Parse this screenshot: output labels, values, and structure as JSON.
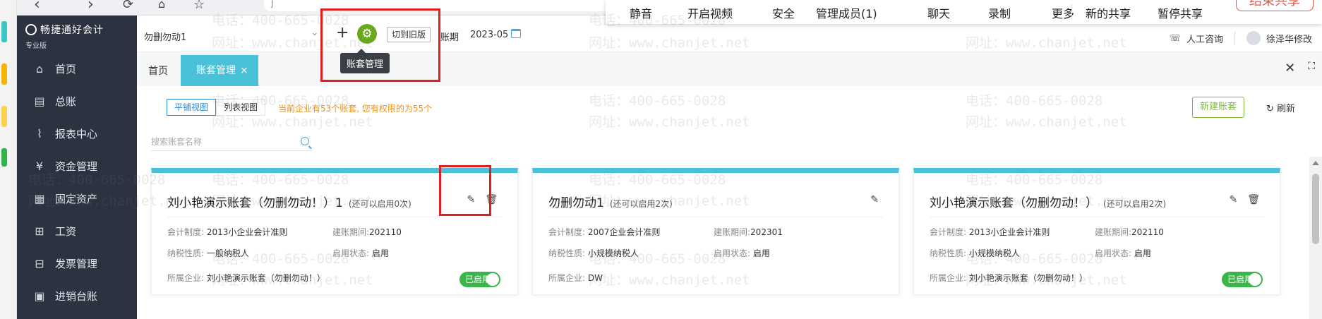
{
  "meeting_bar": {
    "items": [
      "静音",
      "开启视频",
      "安全",
      "管理成员(1)",
      "聊天",
      "录制",
      "更多",
      "新的共享",
      "暂停共享"
    ],
    "end_label": "结束共享"
  },
  "browser": {
    "url_fragment": "j"
  },
  "sidebar": {
    "logo_title": "畅捷通好会计",
    "logo_edition": "专业版",
    "items": [
      {
        "label": "首页",
        "icon": "home-icon"
      },
      {
        "label": "总账",
        "icon": "ledger-icon"
      },
      {
        "label": "报表中心",
        "icon": "chart-icon"
      },
      {
        "label": "资金管理",
        "icon": "money-icon"
      },
      {
        "label": "固定资产",
        "icon": "asset-icon"
      },
      {
        "label": "工资",
        "icon": "salary-icon"
      },
      {
        "label": "发票管理",
        "icon": "invoice-icon"
      },
      {
        "label": "进销台账",
        "icon": "stock-ledger-icon"
      }
    ]
  },
  "header": {
    "current_book": "勿删勿动1",
    "switch_old_label": "切到旧版",
    "period_label": "账期",
    "period_value": "2023-05",
    "tooltip": "账套管理",
    "support_label": "人工咨询",
    "user_name": "徐泽华修改"
  },
  "tabs": {
    "home": "首页",
    "active": "账套管理"
  },
  "toolbar": {
    "view_tile": "平铺视图",
    "view_list": "列表视图",
    "count_note": "当前企业有53个账套, 您有权限的为55个",
    "search_placeholder": "搜索账套名称",
    "new_book": "新建账套",
    "refresh": "刷新"
  },
  "cards": [
    {
      "name": "刘小艳演示账套（勿删勿动！）1",
      "hint": "(还可以启用0次)",
      "accounting_standard_label": "会计制度:",
      "accounting_standard": "2013小企业会计准则",
      "start_period_label": "建账期间:",
      "start_period": "202110",
      "taxpayer_label": "纳税性质:",
      "taxpayer": "一般纳税人",
      "status_label": "启用状态:",
      "status": "启用",
      "company_label": "所属企业:",
      "company": "刘小艳演示账套（勿删勿动！）",
      "toggle_label": "已启用",
      "show_toggle": true
    },
    {
      "name": "勿删勿动1",
      "hint": "(还可以启用2次)",
      "accounting_standard_label": "会计制度:",
      "accounting_standard": "2007企业会计准则",
      "start_period_label": "建账期间:",
      "start_period": "202301",
      "taxpayer_label": "纳税性质:",
      "taxpayer": "小规模纳税人",
      "status_label": "启用状态:",
      "status": "启用",
      "company_label": "所属企业:",
      "company": "DW",
      "toggle_label": "",
      "show_toggle": false
    },
    {
      "name": "刘小艳演示账套（勿删勿动！）",
      "hint": "(还可以启用2次)",
      "accounting_standard_label": "会计制度:",
      "accounting_standard": "2013小企业会计准则",
      "start_period_label": "建账期间:",
      "start_period": "202110",
      "taxpayer_label": "纳税性质:",
      "taxpayer": "小规模纳税人",
      "status_label": "启用状态:",
      "status": "启用",
      "company_label": "所属企业:",
      "company": "刘小艳演示账套（勿删勿动！）",
      "toggle_label": "已启用",
      "show_toggle": true
    }
  ],
  "watermark": {
    "phone": "电话：400-665-0028",
    "site": "网址：www.chanjet.net"
  },
  "colors": {
    "sidebar_bg": "#2c3240",
    "accent_teal": "#49c1d8",
    "gear_green": "#6aa81d",
    "toggle_green": "#39b54a",
    "annotation_red": "#e02020",
    "note_orange": "#e8931e"
  }
}
